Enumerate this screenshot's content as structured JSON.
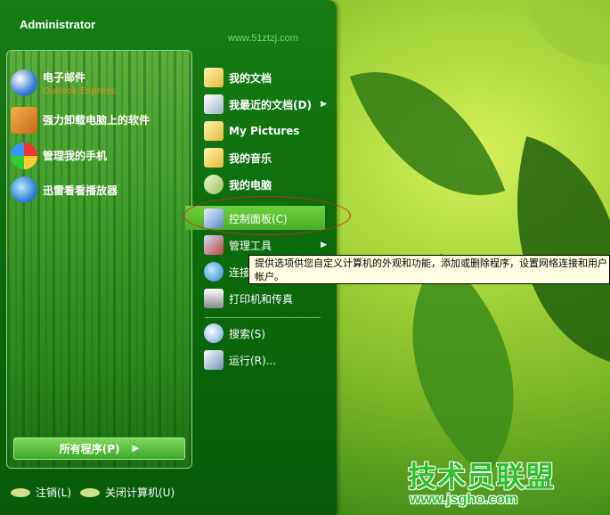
{
  "user": {
    "name": "Administrator"
  },
  "watermark": "www.51ztzj.com",
  "pinned": [
    {
      "label": "电子邮件",
      "sub": "Outlook Express",
      "icon": "email-icon"
    },
    {
      "label": "强力卸载电脑上的软件",
      "sub": "",
      "icon": "uninstall-box-icon"
    },
    {
      "label": "管理我的手机",
      "sub": "",
      "icon": "phone-manager-icon"
    },
    {
      "label": "迅雷看看播放器",
      "sub": "",
      "icon": "player-icon"
    }
  ],
  "all_programs": "所有程序(P)",
  "places": [
    {
      "label": "我的文档",
      "icon": "documents-folder-icon",
      "submenu": false
    },
    {
      "label": "我最近的文档(D)",
      "icon": "recent-documents-icon",
      "submenu": true
    },
    {
      "label": "My Pictures",
      "icon": "pictures-folder-icon",
      "submenu": false
    },
    {
      "label": "我的音乐",
      "icon": "music-folder-icon",
      "submenu": false
    },
    {
      "label": "我的电脑",
      "icon": "computer-icon",
      "submenu": false
    },
    {
      "label": "控制面板(C)",
      "icon": "control-panel-icon",
      "submenu": false
    },
    {
      "label": "管理工具",
      "icon": "admin-tools-icon",
      "submenu": true
    },
    {
      "label": "连接到",
      "icon": "connect-to-icon",
      "submenu": true
    },
    {
      "label": "打印机和传真",
      "icon": "printer-icon",
      "submenu": false
    },
    {
      "label": "搜索(S)",
      "icon": "search-icon",
      "submenu": false
    },
    {
      "label": "运行(R)...",
      "icon": "run-icon",
      "submenu": false
    }
  ],
  "tooltip": "提供选项供您自定义计算机的外观和功能，添加或删除程序，设置网络连接和用户帐户。",
  "footer": {
    "logoff": "注销(L)",
    "shutdown": "关闭计算机(U)"
  },
  "logo": {
    "text": "技术员联盟",
    "url": "www.jsgho.com"
  },
  "colors": {
    "menu_green": "#0b6a0b",
    "highlight": "#5cbf33",
    "tooltip_bg": "#ffffe1"
  }
}
